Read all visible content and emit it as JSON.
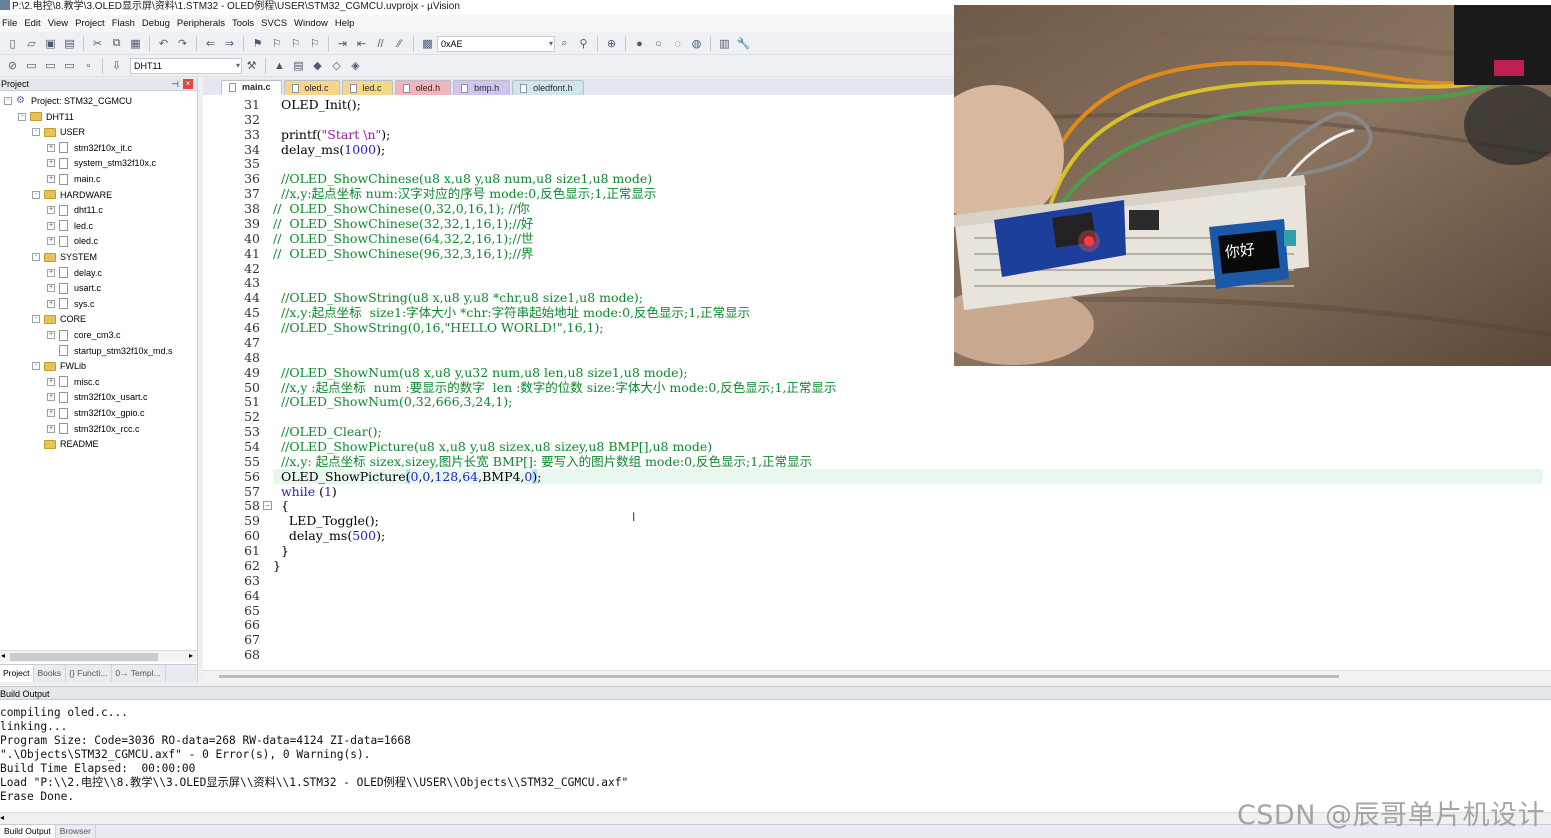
{
  "window": {
    "title": "P:\\2.电控\\8.教学\\3.OLED显示屏\\资料\\1.STM32 - OLED例程\\USER\\STM32_CGMCU.uvprojx - µVision"
  },
  "menu": [
    "File",
    "Edit",
    "View",
    "Project",
    "Flash",
    "Debug",
    "Peripherals",
    "Tools",
    "SVCS",
    "Window",
    "Help"
  ],
  "toolbar": {
    "find_value": "0xAE",
    "target_value": "DHT11"
  },
  "project_panel": {
    "title": "Project",
    "tree": [
      {
        "label": "Project: STM32_CGMCU",
        "type": "project",
        "level": 0,
        "expand": "-"
      },
      {
        "label": "DHT11",
        "type": "folder",
        "level": 1,
        "expand": "-"
      },
      {
        "label": "USER",
        "type": "folder",
        "level": 2,
        "expand": "-"
      },
      {
        "label": "stm32f10x_it.c",
        "type": "file",
        "level": 3,
        "expand": "+"
      },
      {
        "label": "system_stm32f10x.c",
        "type": "file",
        "level": 3,
        "expand": "+"
      },
      {
        "label": "main.c",
        "type": "file",
        "level": 3,
        "expand": "+"
      },
      {
        "label": "HARDWARE",
        "type": "folder",
        "level": 2,
        "expand": "-"
      },
      {
        "label": "dht11.c",
        "type": "file",
        "level": 3,
        "expand": "+"
      },
      {
        "label": "led.c",
        "type": "file",
        "level": 3,
        "expand": "+"
      },
      {
        "label": "oled.c",
        "type": "file",
        "level": 3,
        "expand": "+"
      },
      {
        "label": "SYSTEM",
        "type": "folder",
        "level": 2,
        "expand": "-"
      },
      {
        "label": "delay.c",
        "type": "file",
        "level": 3,
        "expand": "+"
      },
      {
        "label": "usart.c",
        "type": "file",
        "level": 3,
        "expand": "+"
      },
      {
        "label": "sys.c",
        "type": "file",
        "level": 3,
        "expand": "+"
      },
      {
        "label": "CORE",
        "type": "folder",
        "level": 2,
        "expand": "-"
      },
      {
        "label": "core_cm3.c",
        "type": "file",
        "level": 3,
        "expand": "+"
      },
      {
        "label": "startup_stm32f10x_md.s",
        "type": "file",
        "level": 3,
        "expand": ""
      },
      {
        "label": "FWLib",
        "type": "folder",
        "level": 2,
        "expand": "-"
      },
      {
        "label": "misc.c",
        "type": "file",
        "level": 3,
        "expand": "+"
      },
      {
        "label": "stm32f10x_usart.c",
        "type": "file",
        "level": 3,
        "expand": "+"
      },
      {
        "label": "stm32f10x_gpio.c",
        "type": "file",
        "level": 3,
        "expand": "+"
      },
      {
        "label": "stm32f10x_rcc.c",
        "type": "file",
        "level": 3,
        "expand": "+"
      },
      {
        "label": "README",
        "type": "folder",
        "level": 2,
        "expand": ""
      }
    ],
    "tabs": [
      "Project",
      "Books",
      "{} Functi...",
      "0→ Templ..."
    ]
  },
  "editor": {
    "tabs": [
      "main.c",
      "oled.c",
      "led.c",
      "oled.h",
      "bmp.h",
      "oledfont.h"
    ],
    "active_tab": "main.c",
    "lines": [
      {
        "n": "31",
        "text": "  OLED_Init();",
        "kind": "code"
      },
      {
        "n": "32",
        "text": "",
        "kind": "code"
      },
      {
        "n": "33",
        "text": "  printf(\"Start \\n\");",
        "kind": "printf"
      },
      {
        "n": "34",
        "text": "  delay_ms(1000);",
        "kind": "delay1000"
      },
      {
        "n": "35",
        "text": "",
        "kind": "code"
      },
      {
        "n": "36",
        "text": "  //OLED_ShowChinese(u8 x,u8 y,u8 num,u8 size1,u8 mode)",
        "kind": "comment"
      },
      {
        "n": "37",
        "text": "  //x,y:起点坐标 num:汉字对应的序号 mode:0,反色显示;1,正常显示",
        "kind": "comment"
      },
      {
        "n": "38",
        "text": "//  OLED_ShowChinese(0,32,0,16,1); //你",
        "kind": "comment"
      },
      {
        "n": "39",
        "text": "//  OLED_ShowChinese(32,32,1,16,1);//好",
        "kind": "comment"
      },
      {
        "n": "40",
        "text": "//  OLED_ShowChinese(64,32,2,16,1);//世",
        "kind": "comment"
      },
      {
        "n": "41",
        "text": "//  OLED_ShowChinese(96,32,3,16,1);//界",
        "kind": "comment"
      },
      {
        "n": "42",
        "text": "",
        "kind": "code"
      },
      {
        "n": "43",
        "text": "",
        "kind": "code"
      },
      {
        "n": "44",
        "text": "  //OLED_ShowString(u8 x,u8 y,u8 *chr,u8 size1,u8 mode);",
        "kind": "comment"
      },
      {
        "n": "45",
        "text": "  //x,y:起点坐标  size1:字体大小 *chr:字符串起始地址 mode:0,反色显示;1,正常显示",
        "kind": "comment"
      },
      {
        "n": "46",
        "text": "  //OLED_ShowString(0,16,\"HELLO WORLD!\",16,1);",
        "kind": "comment"
      },
      {
        "n": "47",
        "text": "",
        "kind": "code"
      },
      {
        "n": "48",
        "text": "",
        "kind": "code"
      },
      {
        "n": "49",
        "text": "  //OLED_ShowNum(u8 x,u8 y,u32 num,u8 len,u8 size1,u8 mode);",
        "kind": "comment"
      },
      {
        "n": "50",
        "text": "  //x,y :起点坐标  num :要显示的数字  len :数字的位数 size:字体大小 mode:0,反色显示;1,正常显示",
        "kind": "comment"
      },
      {
        "n": "51",
        "text": "  //OLED_ShowNum(0,32,666,3,24,1);",
        "kind": "comment"
      },
      {
        "n": "52",
        "text": "",
        "kind": "code"
      },
      {
        "n": "53",
        "text": "  //OLED_Clear();",
        "kind": "comment"
      },
      {
        "n": "54",
        "text": "  //OLED_ShowPicture(u8 x,u8 y,u8 sizex,u8 sizey,u8 BMP[],u8 mode)",
        "kind": "comment"
      },
      {
        "n": "55",
        "text": "  //x,y: 起点坐标 sizex,sizey,图片长宽 BMP[]: 要写入的图片数组 mode:0,反色显示;1,正常显示",
        "kind": "comment"
      },
      {
        "n": "56",
        "text": "  OLED_ShowPicture(0,0,128,64,BMP4,0);",
        "kind": "showpic"
      },
      {
        "n": "57",
        "text": "  while (1)",
        "kind": "while"
      },
      {
        "n": "58",
        "text": "  {",
        "kind": "code"
      },
      {
        "n": "59",
        "text": "    LED_Toggle();",
        "kind": "code"
      },
      {
        "n": "60",
        "text": "    delay_ms(500);",
        "kind": "delay500"
      },
      {
        "n": "61",
        "text": "  }",
        "kind": "code"
      },
      {
        "n": "62",
        "text": "}",
        "kind": "code"
      },
      {
        "n": "63",
        "text": "",
        "kind": "code"
      },
      {
        "n": "64",
        "text": "",
        "kind": "code"
      },
      {
        "n": "65",
        "text": "",
        "kind": "code"
      },
      {
        "n": "66",
        "text": "",
        "kind": "code"
      },
      {
        "n": "67",
        "text": "",
        "kind": "code"
      },
      {
        "n": "68",
        "text": "",
        "kind": "code"
      }
    ]
  },
  "oled_text": "你好",
  "build_output": {
    "title": "Build Output",
    "lines": [
      "compiling oled.c...",
      "linking...",
      "Program Size: Code=3036 RO-data=268 RW-data=4124 ZI-data=1668",
      "\".\\Objects\\STM32_CGMCU.axf\" - 0 Error(s), 0 Warning(s).",
      "Build Time Elapsed:  00:00:00",
      "Load \"P:\\\\2.电控\\\\8.教学\\\\3.OLED显示屏\\\\资料\\\\1.STM32 - OLED例程\\\\USER\\\\Objects\\\\STM32_CGMCU.axf\"",
      "Erase Done."
    ],
    "tabs": [
      "Build Output",
      "Browser"
    ]
  },
  "watermark": "CSDN @辰哥单片机设计"
}
